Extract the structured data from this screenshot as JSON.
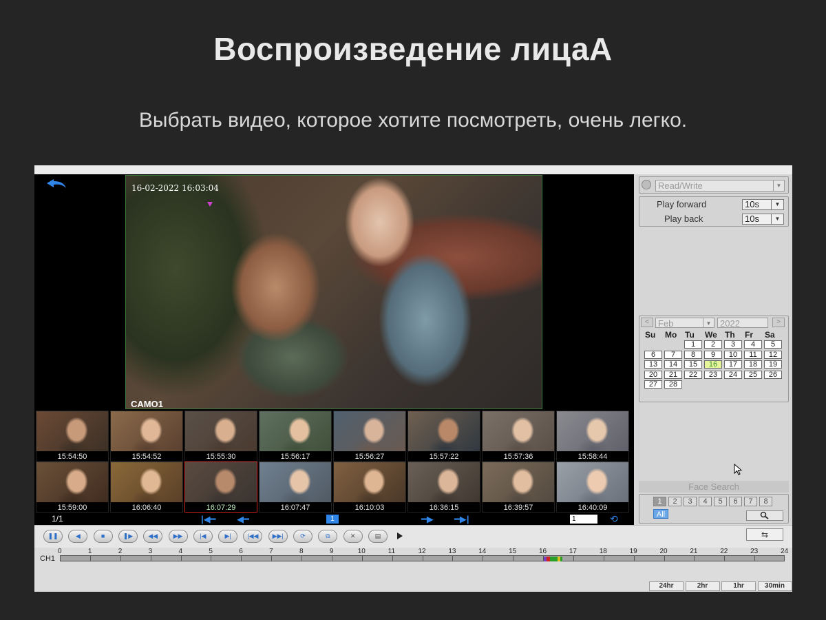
{
  "page": {
    "title": "Воспроизведение лицаA",
    "subtitle": "Выбрать видео, которое хотите посмотреть, очень легко."
  },
  "video": {
    "timestamp": "16-02-2022 16:03:04",
    "camera_label": "CAMO1"
  },
  "thumbnails": [
    {
      "time": "15:54:50"
    },
    {
      "time": "15:54:52"
    },
    {
      "time": "15:55:30"
    },
    {
      "time": "15:56:17"
    },
    {
      "time": "15:56:27"
    },
    {
      "time": "15:57:22"
    },
    {
      "time": "15:57:36"
    },
    {
      "time": "15:58:44"
    },
    {
      "time": "15:59:00"
    },
    {
      "time": "16:06:40"
    },
    {
      "time": "16:07:29",
      "selected": true
    },
    {
      "time": "16:07:47"
    },
    {
      "time": "16:10:03"
    },
    {
      "time": "16:36:15"
    },
    {
      "time": "16:39:57"
    },
    {
      "time": "16:40:09"
    }
  ],
  "thumb_nav": {
    "page_indicator": "1/1",
    "current_page": "1",
    "page_input": "1",
    "first_icon": "skip-to-first-icon",
    "prev_icon": "arrow-left-icon",
    "next_icon": "arrow-right-icon",
    "last_icon": "skip-to-last-icon",
    "refresh_icon": "refresh-icon"
  },
  "sidebar": {
    "mode_select": "Read/Write",
    "play_forward_label": "Play forward",
    "play_forward_value": "10s",
    "play_back_label": "Play back",
    "play_back_value": "10s",
    "calendar": {
      "month": "Feb",
      "year": "2022",
      "weekdays": [
        "Su",
        "Mo",
        "Tu",
        "We",
        "Th",
        "Fr",
        "Sa"
      ],
      "days": [
        "1",
        "2",
        "3",
        "4",
        "5",
        "6",
        "7",
        "8",
        "9",
        "10",
        "11",
        "12",
        "13",
        "14",
        "15",
        "16",
        "17",
        "18",
        "19",
        "20",
        "21",
        "22",
        "23",
        "24",
        "25",
        "26",
        "27",
        "28"
      ],
      "first_weekday_index": 2,
      "selected_day": "16"
    },
    "face_search_label": "Face Search",
    "channels": [
      "1",
      "2",
      "3",
      "4",
      "5",
      "6",
      "7",
      "8"
    ],
    "active_channel": "1",
    "all_label": "All",
    "search_icon": "search-icon"
  },
  "controls": {
    "buttons": [
      "pause-icon",
      "play-reverse-icon",
      "stop-icon",
      "play-icon",
      "rewind-icon",
      "fast-forward-icon",
      "step-back-icon",
      "step-forward-icon",
      "previous-file-icon",
      "next-file-icon",
      "loop-icon",
      "clip-icon",
      "close-icon",
      "save-icon"
    ],
    "play_icon": "play-triangle-icon",
    "sync_icon": "sync-icon"
  },
  "timeline": {
    "channel_label": "CH1",
    "hours": [
      "0",
      "1",
      "2",
      "3",
      "4",
      "5",
      "6",
      "7",
      "8",
      "9",
      "10",
      "11",
      "12",
      "13",
      "14",
      "15",
      "16",
      "17",
      "18",
      "19",
      "20",
      "21",
      "22",
      "23",
      "24"
    ],
    "zoom_buttons": [
      "24hr",
      "2hr",
      "1hr",
      "30min"
    ],
    "colors": {
      "record_purple": "#7a3fbf",
      "record_red": "#d02020",
      "record_green": "#2aa02a",
      "record_yellow": "#d8c020"
    }
  }
}
